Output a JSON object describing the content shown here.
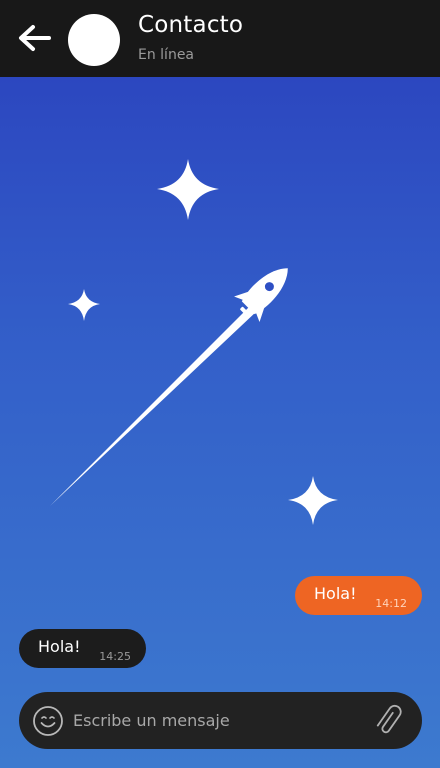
{
  "header": {
    "contact_name": "Contacto",
    "status": "En línea",
    "back_icon": "arrow-left-icon",
    "background": "#181818"
  },
  "illustration": {
    "rocket_icon": "rocket-icon",
    "star_icon": "sparkle-star-icon"
  },
  "messages": [
    {
      "direction": "outgoing",
      "text": "Hola!",
      "time": "14:12",
      "color": "#ee6523"
    },
    {
      "direction": "incoming",
      "text": "Hola!",
      "time": "14:25",
      "color": "#1c1c1c"
    }
  ],
  "composer": {
    "placeholder": "Escribe un mensaje",
    "value": "",
    "emoji_icon": "smiley-icon",
    "attach_icon": "paperclip-icon"
  }
}
